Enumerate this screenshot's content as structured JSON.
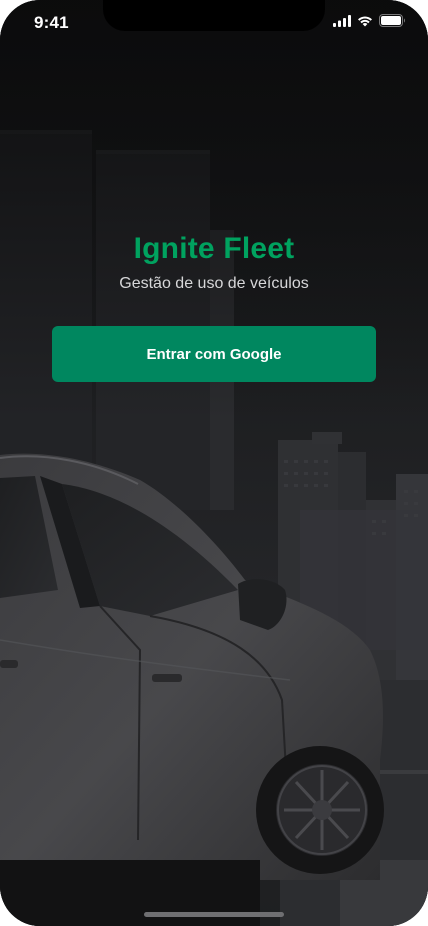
{
  "status_bar": {
    "time": "9:41",
    "icons": [
      "cellular-signal-icon",
      "wifi-icon",
      "battery-icon"
    ]
  },
  "hero": {
    "title": "Ignite Fleet",
    "subtitle": "Gestão de uso de veículos"
  },
  "actions": {
    "google_signin_label": "Entrar com Google"
  },
  "colors": {
    "brand_green_text": "#00A25F",
    "button_green": "#00875F",
    "background_dark": "#1B1B1D",
    "subtitle_text": "#D7D7D9"
  },
  "background_image": "dark-city-skyline-with-car"
}
